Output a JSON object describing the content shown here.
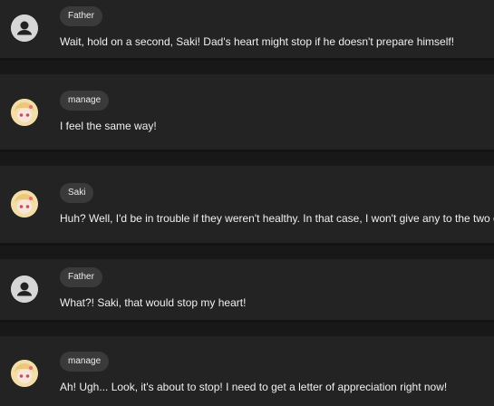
{
  "messages": [
    {
      "speaker": "Father",
      "avatar": "default-person-icon",
      "text": "Wait, hold on a second, Saki! Dad's heart might stop if he doesn't prepare himself!"
    },
    {
      "speaker": "manage",
      "avatar": "anime-girl-avatar",
      "text": "I feel the same way!"
    },
    {
      "speaker": "Saki",
      "avatar": "anime-girl-avatar",
      "text": "Huh? Well, I'd be in trouble if they weren't healthy. In that case, I won't give any to the two of"
    },
    {
      "speaker": "Father",
      "avatar": "default-person-icon",
      "text": "What?! Saki, that would stop my heart!"
    },
    {
      "speaker": "manage",
      "avatar": "anime-girl-avatar",
      "text": "Ah! Ugh... Look, it's about to stop! I need to get a letter of appreciation right now!"
    }
  ]
}
